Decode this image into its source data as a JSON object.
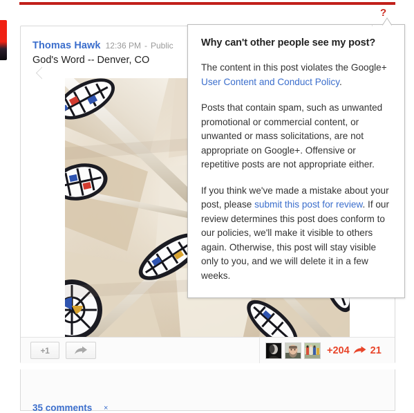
{
  "page": {
    "accent_red": "#c1201b",
    "link_blue": "#3b6ecc",
    "count_red": "#e8452a"
  },
  "help": {
    "question_icon": "?",
    "icon_name": "help-question-icon"
  },
  "post": {
    "author": "Thomas Hawk",
    "time": "12:36 PM",
    "separator": "-",
    "visibility": "Public",
    "text": "God's Word -- Denver, CO",
    "photo_alt": "cathedral-ceiling-photo"
  },
  "actions": {
    "plusone_label": "+1",
    "share_icon": "share-arrow-icon",
    "plusone_count": "+204",
    "reshare_count": "21",
    "reshare_icon": "reshare-arrow-icon",
    "resharer_avatars": [
      "avatar-bw-portrait",
      "avatar-bearded-man",
      "avatar-group-photo"
    ]
  },
  "comments": {
    "label": "35 comments",
    "expand_icon": "×"
  },
  "tooltip": {
    "title": "Why can't other people see my post?",
    "para1_a": "The content in this post violates the Google+ ",
    "para1_link": "User Content and Conduct Policy",
    "para1_b": ".",
    "para2": "Posts that contain spam, such as unwanted promotional or commercial content, or unwanted or mass solicitations, are not appropriate on Google+. Offensive or repetitive posts are not appropriate either.",
    "para3_a": "If you think we've made a mistake about your post, please ",
    "para3_link": "submit this post for review",
    "para3_b": ". If our review determines this post does conform to our policies, we'll make it visible to others again. Otherwise, this post will stay visible only to you, and we will delete it in a few weeks."
  }
}
